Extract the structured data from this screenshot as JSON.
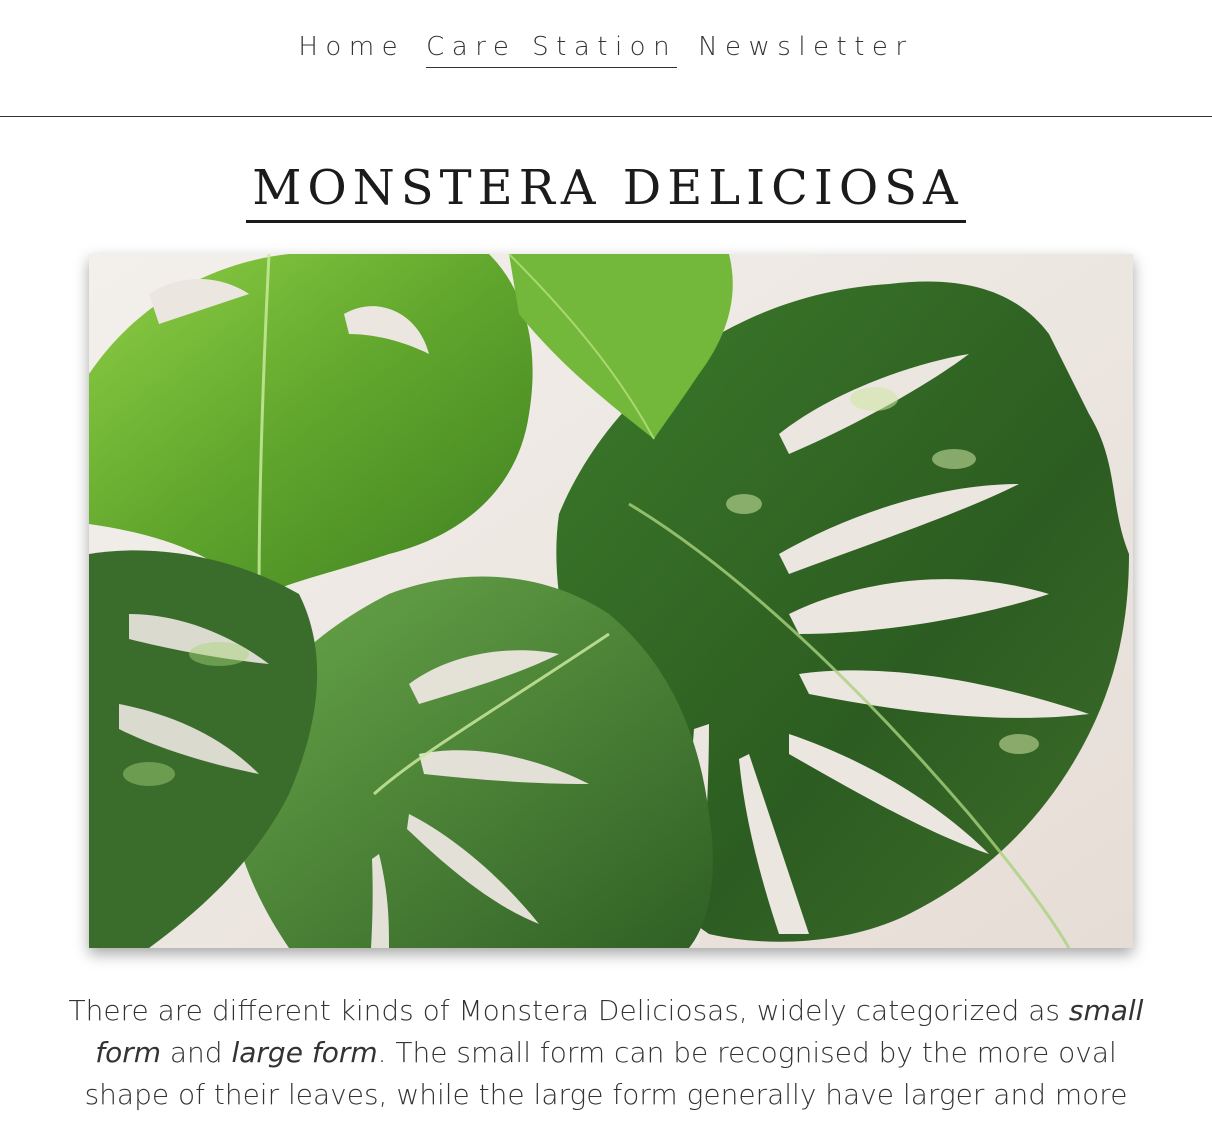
{
  "nav": {
    "items": [
      {
        "label": "Home",
        "active": false
      },
      {
        "label": "Care Station",
        "active": true
      },
      {
        "label": "Newsletter",
        "active": false
      }
    ]
  },
  "page": {
    "title": "MONSTERA DELICIOSA",
    "intro": {
      "line1_pre": "There are different kinds of Monstera Deliciosas, widely categorized as ",
      "line1_em": "small",
      "line2_em_a": "form",
      "line2_mid": " and ",
      "line2_em_b": "large form",
      "line2_post": ". The small form can be recognised by the more oval",
      "line3": "shape of their leaves, while the large form generally have larger and more"
    }
  },
  "colors": {
    "text": "#333333",
    "rule": "#333333",
    "leaf_light": "#7cc23a",
    "leaf_dark": "#2f5f22",
    "wall": "#efeae6"
  }
}
